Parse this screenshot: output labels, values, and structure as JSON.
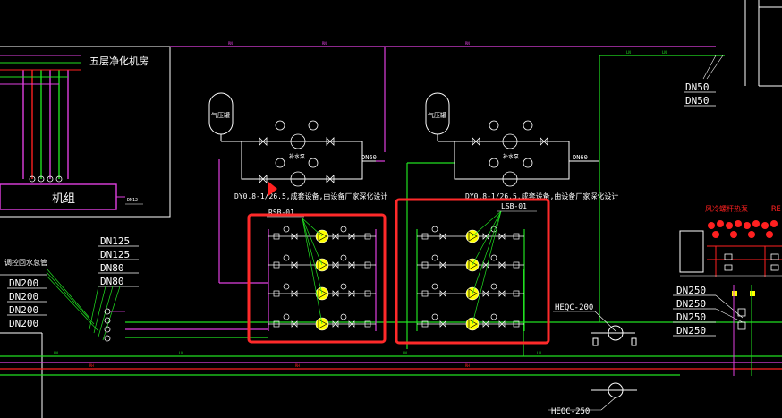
{
  "colors": {
    "background": "#000000",
    "magenta": "#e040e0",
    "green": "#20e020",
    "white": "#ffffff",
    "red": "#ff2020",
    "yellow": "#ffff00",
    "highlight": "#ff2a2a"
  },
  "labels": {
    "room_title": "五层净化机房",
    "unit": "机组",
    "unit_tag": "DN12",
    "tank_left": "气压罐",
    "tank_right": "气压罐",
    "pump_left": "补水泵",
    "pump_right": "补水泵",
    "dn60_left": "DN60",
    "dn60_right": "DN60",
    "note_left": "DY0.8-1/26.5,成套设备,由设备厂家深化设计",
    "note_right": "DY0.8-1/26.5,成套设备,由设备厂家深化设计",
    "rsb": "RSB-01",
    "lsb": "LSB-01",
    "heqc200": "HEQC-200",
    "heqc250": "HEQC-250",
    "return_note": "调控回水总管",
    "top_right_note": "风冷螺杆热泵",
    "top_right_cut": "RE"
  },
  "dn_left_small": [
    "DN125",
    "DN125",
    "DN80",
    "DN80"
  ],
  "dn_left_big": [
    "DN200",
    "DN200",
    "DN200",
    "DN200"
  ],
  "dn_top_right": [
    "DN50",
    "DN50"
  ],
  "dn_right": [
    "DN250",
    "DN250",
    "DN250",
    "DN250"
  ],
  "pipe_tags": {
    "cold": "LN",
    "hot": "RN",
    "make": "RH",
    "frame": "LN"
  },
  "icons": [
    "pressure-tank-icon",
    "pump-icon",
    "valve-icon",
    "gauge-icon",
    "flow-meter-icon"
  ]
}
